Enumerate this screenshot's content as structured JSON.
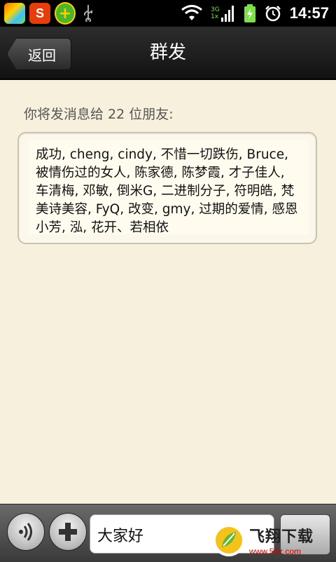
{
  "status_bar": {
    "time": "14:57",
    "network_label": "3G",
    "network_sublabel": "1x",
    "notification_icons": [
      "colorful-app-icon",
      "sogou-input-icon",
      "360-security-icon",
      "usb-icon"
    ],
    "status_icons": [
      "wifi-icon",
      "signal-icon",
      "battery-charging-icon",
      "alarm-icon"
    ]
  },
  "header": {
    "back_label": "返回",
    "title": "群发"
  },
  "main": {
    "recipient_summary": "你将发消息给 22 位朋友:",
    "recipients_text": "成功, cheng, cindy, 不惜一切跌伤, Bruce, 被情伤过的女人, 陈家德, 陈梦霞, 才子佳人, 车清梅, 邓敏, 倒米G, 二进制分子, 符明皓, 梵美诗美容, FyQ, 改变, gmy, 过期的爱情, 感恩 小芳, 泓, 花开、若相依"
  },
  "composer": {
    "message_value": "大家好",
    "voice_icon": "voice-wave-icon",
    "plus_icon": "plus-icon"
  },
  "watermark": {
    "title": "飞翔下载",
    "url": "www.52z.com"
  },
  "colors": {
    "background": "#f6f0dc",
    "titlebar": "#1c1c1c",
    "accent_green": "#4ab52a"
  }
}
